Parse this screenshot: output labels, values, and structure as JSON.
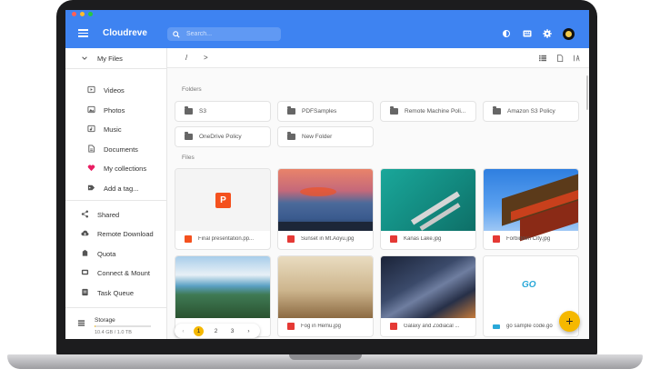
{
  "app": {
    "title": "Cloudreve"
  },
  "search": {
    "placeholder": "Search..."
  },
  "colors": {
    "appbar": "#3e83f1",
    "accent": "#f5b800",
    "heart": "#e91e63",
    "file_image": "#e53935",
    "file_ppt": "#f4511e"
  },
  "sidebar": {
    "my_files": "My Files",
    "items": [
      {
        "label": "Videos",
        "icon": "video-icon"
      },
      {
        "label": "Photos",
        "icon": "photo-icon"
      },
      {
        "label": "Music",
        "icon": "music-icon"
      },
      {
        "label": "Documents",
        "icon": "document-icon"
      },
      {
        "label": "My collections",
        "icon": "heart-icon"
      },
      {
        "label": "Add a tag...",
        "icon": "tag-icon"
      }
    ],
    "nav": [
      {
        "label": "Shared",
        "icon": "share-icon"
      },
      {
        "label": "Remote Download",
        "icon": "cloud-download-icon"
      },
      {
        "label": "Quota",
        "icon": "quota-icon"
      },
      {
        "label": "Connect & Mount",
        "icon": "link-icon"
      },
      {
        "label": "Task Queue",
        "icon": "task-icon"
      }
    ],
    "storage": {
      "label": "Storage",
      "value": "10.4 GB / 1.0 TB",
      "fraction": 0.01
    }
  },
  "breadcrumb": {
    "root": "/",
    "separator": ">"
  },
  "sections": {
    "folders": "Folders",
    "files": "Files"
  },
  "folders": [
    "S3",
    "PDFSamples",
    "Remote Machine Poli...",
    "Amazon S3 Policy",
    "OneDrive Policy",
    "New Folder"
  ],
  "files": [
    {
      "name": "Final presentation.pp...",
      "type": "ppt"
    },
    {
      "name": "Sunset in Mt.Aoyu.jpg",
      "type": "image"
    },
    {
      "name": "Kanas Lake.jpg",
      "type": "image"
    },
    {
      "name": "Forbidden City.jpg",
      "type": "image"
    },
    {
      "name": "Fog in Hemu.jpg",
      "type": "image"
    },
    {
      "name": "Galaxy and Zodiacal ...",
      "type": "image"
    },
    {
      "name": "go sample code.go",
      "type": "code"
    }
  ],
  "thumb_text": {
    "ppt": "P",
    "go": "GO"
  },
  "pagination": {
    "pages": [
      "1",
      "2",
      "3"
    ],
    "current": "1",
    "prev": "‹",
    "next": "›"
  },
  "fab": {
    "label": "+"
  }
}
